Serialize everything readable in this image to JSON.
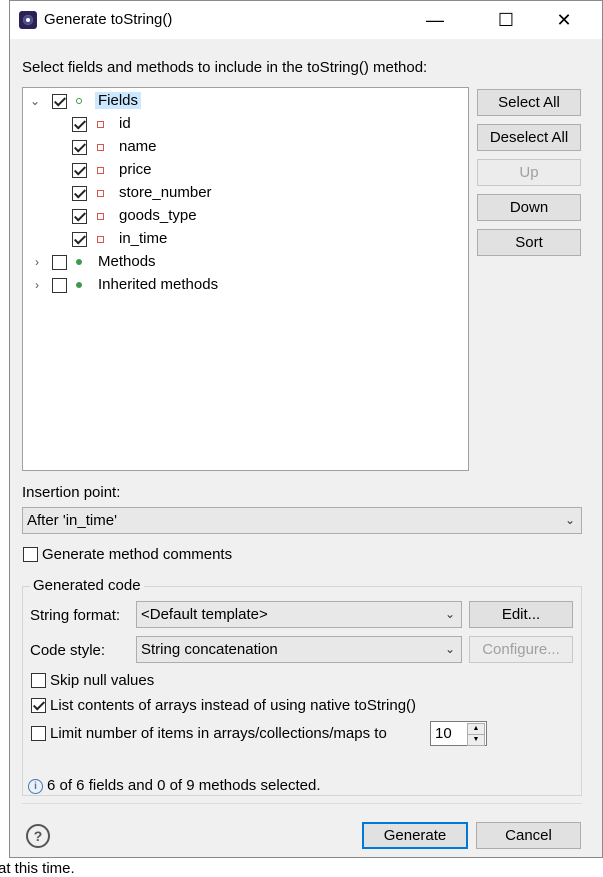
{
  "window": {
    "title": "Generate toString()",
    "minimize": "—",
    "maximize": "☐",
    "close": "✕"
  },
  "background": {
    "bottom_text": "at this time."
  },
  "instructions": "Select fields and methods to include in the toString() method:",
  "tree": {
    "fields": {
      "label": "Fields",
      "checked": true,
      "expanded": true
    },
    "field_items": [
      {
        "label": "id",
        "checked": true
      },
      {
        "label": "name",
        "checked": true
      },
      {
        "label": "price",
        "checked": true
      },
      {
        "label": "store_number",
        "checked": true
      },
      {
        "label": "goods_type",
        "checked": true
      },
      {
        "label": "in_time",
        "checked": true
      }
    ],
    "methods": {
      "label": "Methods",
      "checked": false,
      "expanded": false
    },
    "inherited": {
      "label": "Inherited methods",
      "checked": false,
      "expanded": false
    }
  },
  "side_buttons": {
    "select_all": "Select All",
    "deselect_all": "Deselect All",
    "up": "Up",
    "down": "Down",
    "sort": "Sort"
  },
  "insertion": {
    "label": "Insertion point:",
    "value": "After 'in_time'"
  },
  "generate_comments": {
    "label": "Generate method comments",
    "checked": false
  },
  "generated_code": {
    "title": "Generated code",
    "string_format_label": "String format:",
    "string_format_value": "<Default template>",
    "edit_button": "Edit...",
    "code_style_label": "Code style:",
    "code_style_value": "String concatenation",
    "configure_button": "Configure...",
    "skip_null": {
      "label": "Skip null values",
      "checked": false
    },
    "list_arrays": {
      "label": "List contents of arrays instead of using native toString()",
      "checked": true
    },
    "limit_items": {
      "label": "Limit number of items in arrays/collections/maps to",
      "checked": false
    },
    "limit_value": "10"
  },
  "status": "6 of 6 fields and 0 of 9 methods selected.",
  "footer": {
    "generate": "Generate",
    "cancel": "Cancel"
  },
  "colors": {
    "accent": "#0078d7",
    "selection": "#cce8ff",
    "keyword": "#7f0055",
    "field_icon": "#d9534f",
    "method_icon": "#3c9a49"
  }
}
